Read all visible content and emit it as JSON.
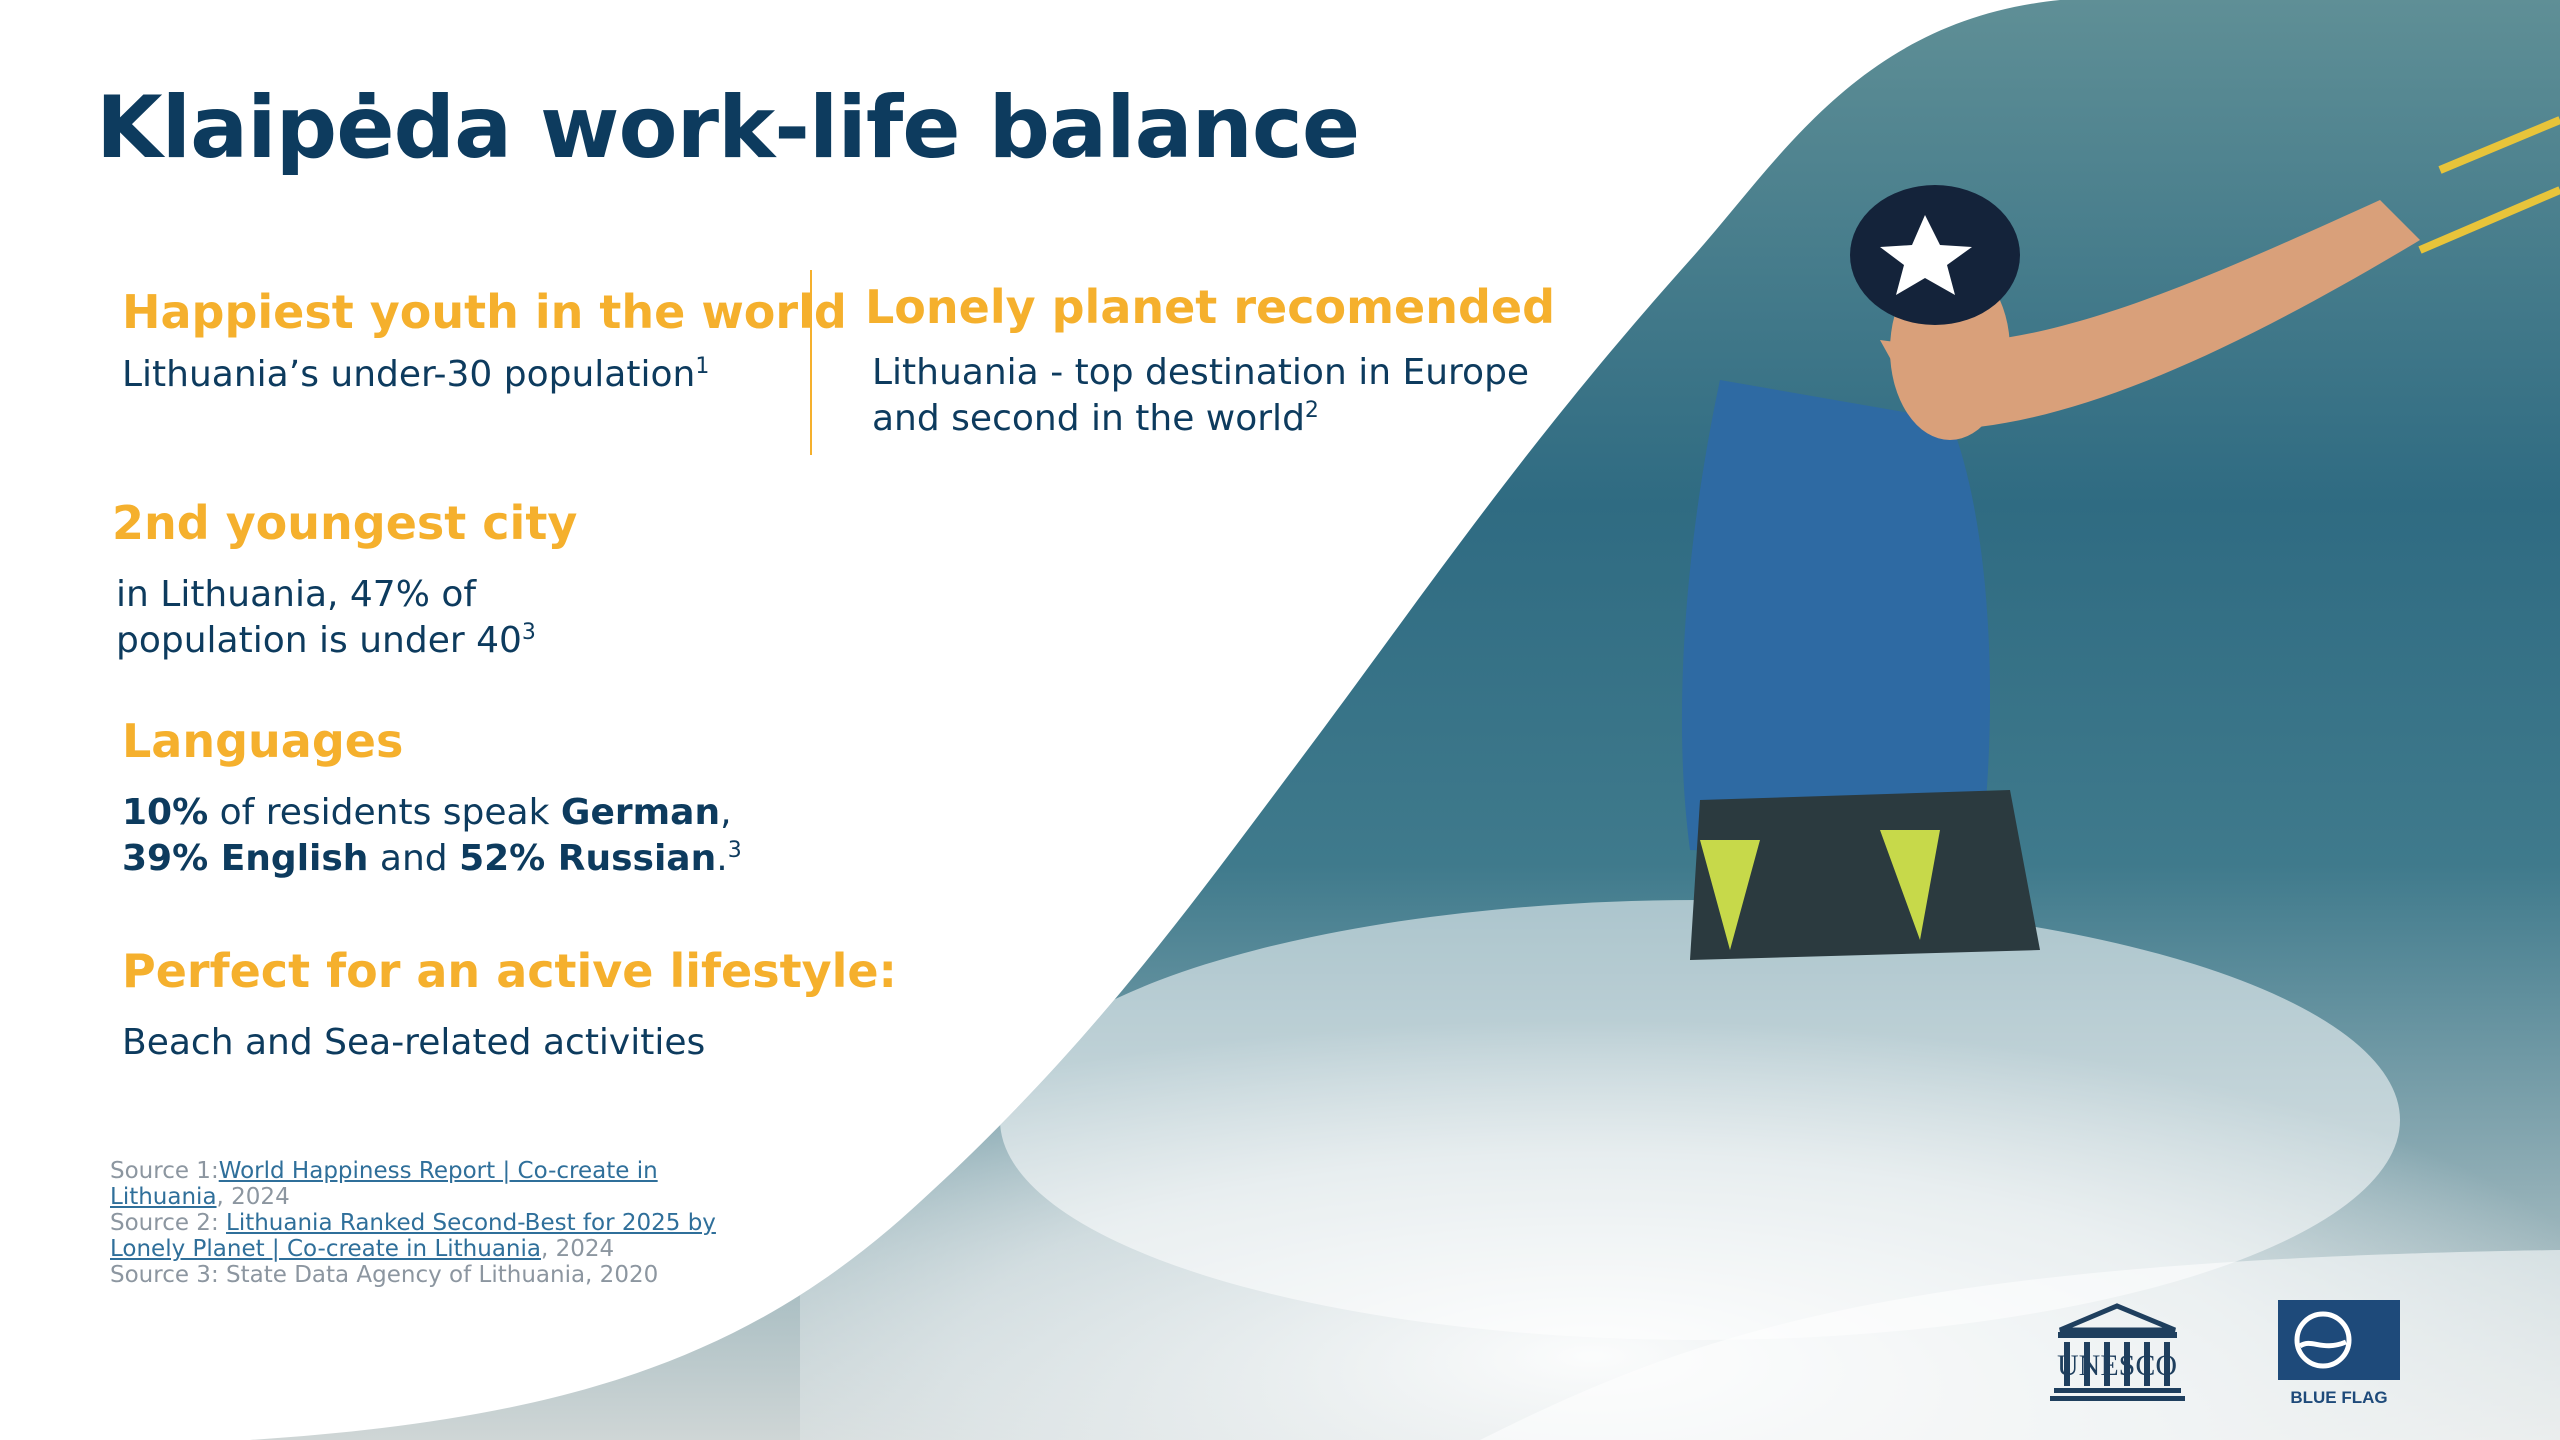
{
  "title": "Klaipėda work-life balance",
  "sections": {
    "happiest": {
      "heading": "Happiest youth in the world",
      "text": "Lithuania’s under-30 population",
      "sup": "1"
    },
    "lonely": {
      "heading": "Lonely planet recomended",
      "line1": "Lithuania - top destination in Europe",
      "line2": "and second in the world",
      "sup": "2"
    },
    "youngest": {
      "heading": "2nd youngest city",
      "line1": "in Lithuania, 47% of",
      "line2": "population is under 40",
      "sup": "3"
    },
    "languages": {
      "heading": "Languages",
      "p1": "10%",
      "t1": " of residents speak ",
      "p2": "German",
      "t2": ",",
      "p3": "39% English",
      "t3": " and ",
      "p4": "52% Russian",
      "t4": ".",
      "sup": "3"
    },
    "active": {
      "heading": "Perfect for an active lifestyle:",
      "text": "Beach and Sea-related activities"
    }
  },
  "sources": {
    "s1_prefix": "Source 1:",
    "s1_link": "World Happiness Report | Co-create in Lithuania",
    "s1_suffix": ", 2024",
    "s2_prefix": "Source 2: ",
    "s2_link": "Lithuania Ranked Second-Best for 2025 by Lonely Planet | Co-create in Lithuania",
    "s2_suffix": ", 2024",
    "s3": "Source 3: State Data Agency of Lithuania, 2020"
  },
  "logos": {
    "unesco": "UNESCO",
    "blueflag": "BLUE FLAG"
  },
  "colors": {
    "navy": "#0d3b5e",
    "accent": "#f5b02d",
    "water": "#2f6b82"
  }
}
